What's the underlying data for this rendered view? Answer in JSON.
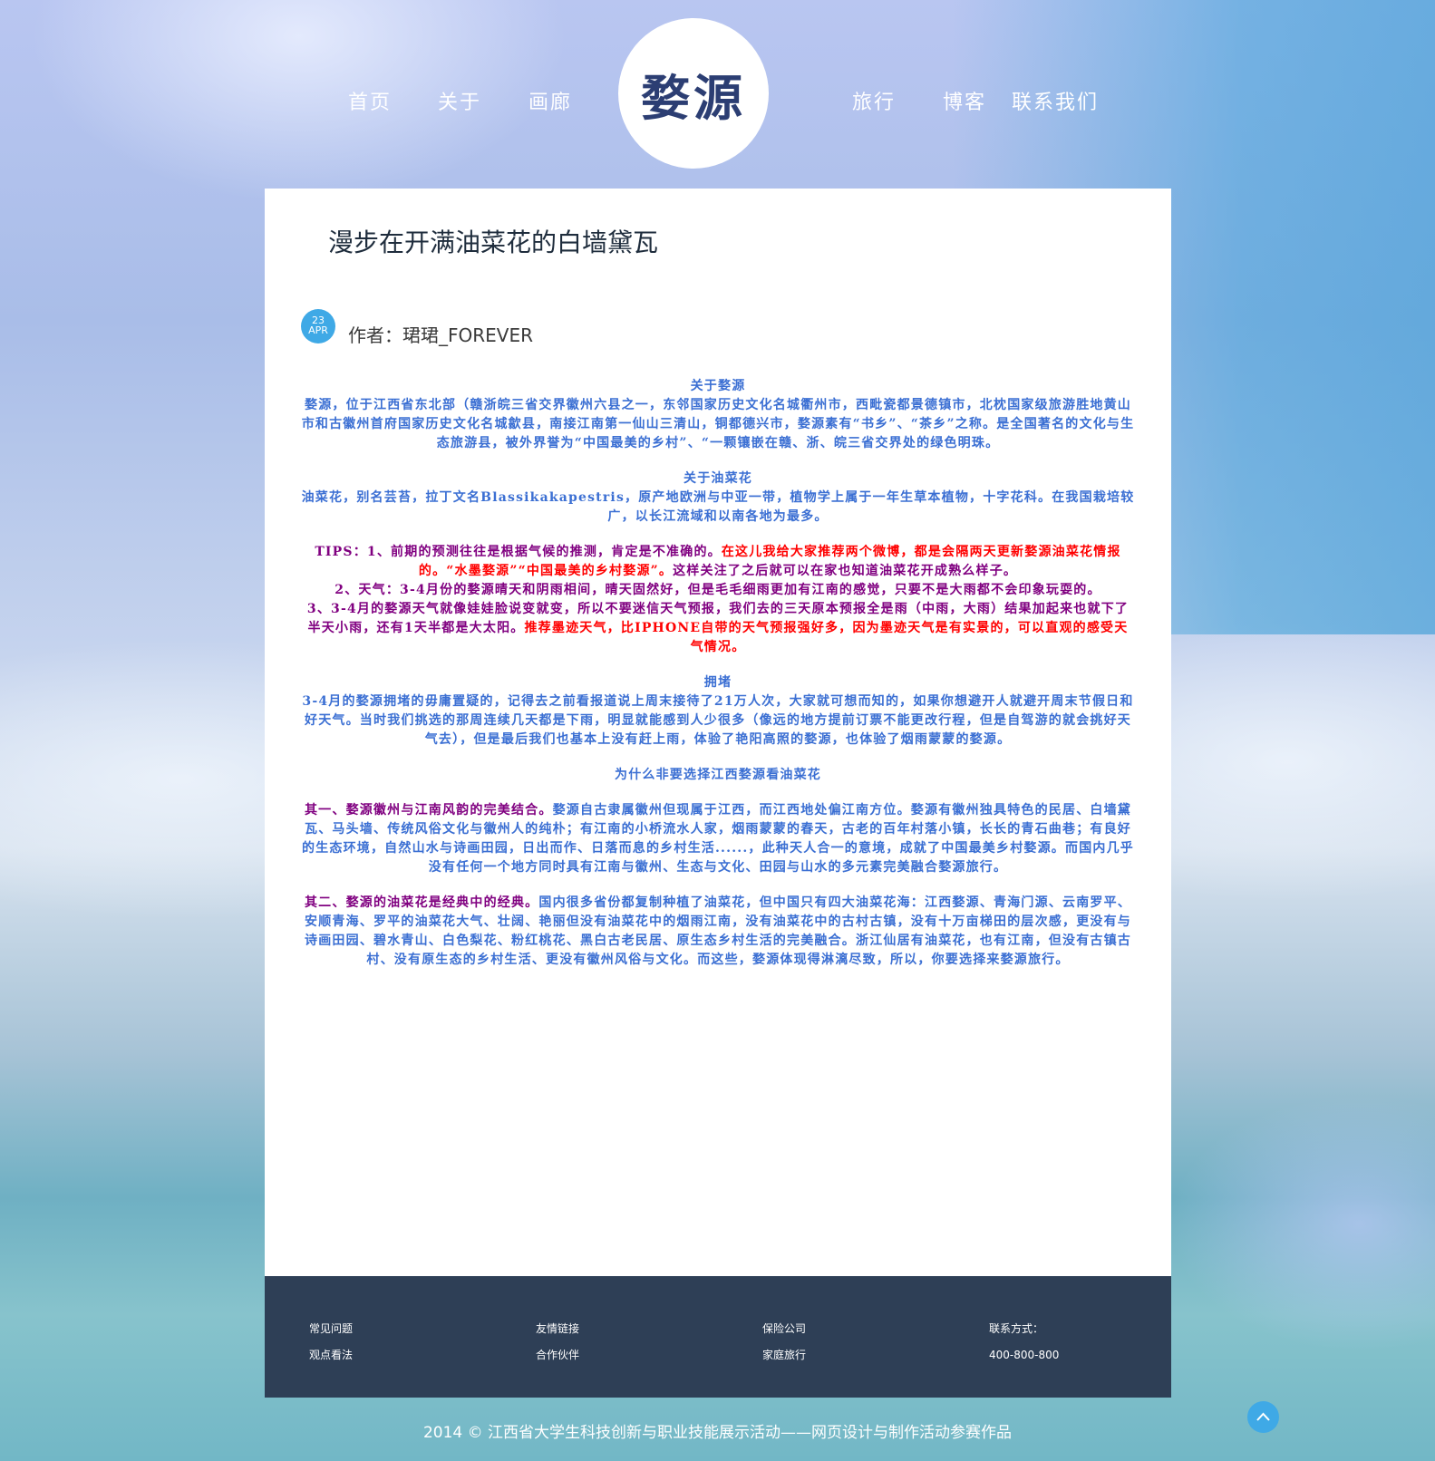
{
  "nav": {
    "items": [
      "首页",
      "关于",
      "画廊",
      "旅行",
      "博客",
      "联系我们"
    ],
    "logo_text": "婺源"
  },
  "post": {
    "title": "漫步在开满油菜花的白墙黛瓦",
    "date_day": "23",
    "date_month": "APR",
    "author": "作者：珺珺_FOREVER"
  },
  "article": {
    "s1_heading": "关于婺源",
    "s1_body": "婺源，位于江西省东北部（赣浙皖三省交界徽州六县之一，东邻国家历史文化名城衢州市，西毗瓷都景德镇市，北枕国家级旅游胜地黄山市和古徽州首府国家历史文化名城歙县，南接江南第一仙山三清山，铜都德兴市，婺源素有“书乡”、“茶乡”之称。是全国著名的文化与生态旅游县，被外界誉为“中国最美的乡村”、“一颗镶嵌在赣、浙、皖三省交界处的绿色明珠。",
    "s2_heading": "关于油菜花",
    "s2_body": "油菜花，别名芸苔，拉丁文名Blassikakapestris，原产地欧洲与中亚一带，植物学上属于一年生草本植物，十字花科。在我国栽培较广，以长江流域和以南各地为最多。",
    "tips_a": "TIPS：1、前期的预测往往是根据气候的推测，肯定是不准确的。",
    "tips_b": "在这儿我给大家推荐两个微博，都是会隔两天更新婺源油菜花情报的。“水墨婺源”“中国最美的乡村婺源”。",
    "tips_c": "这样关注了之后就可以在家也知道油菜花开成熟么样子。",
    "tips_2": "2、天气：3-4月份的婺源晴天和阴雨相间，晴天固然好，但是毛毛细雨更加有江南的感觉，只要不是大雨都不会印象玩耍的。",
    "tips_3a": "3、3-4月的婺源天气就像娃娃脸说变就变，所以不要迷信天气预报，我们去的三天原本预报全是雨（中雨，大雨）结果加起来也就下了半天小雨，还有1天半都是大太阳。",
    "tips_3b": "推荐墨迹天气，比IPHONE自带的天气预报强好多，因为墨迹天气是有实景的，可以直观的感受天气情况。",
    "s3_heading": "拥堵",
    "s3_body": "3-4月的婺源拥堵的毋庸置疑的，记得去之前看报道说上周末接待了21万人次，大家就可想而知的，如果你想避开人就避开周末节假日和好天气。当时我们挑选的那周连续几天都是下雨，明显就能感到人少很多（像远的地方提前订票不能更改行程，但是自驾游的就会挑好天气去），但是最后我们也基本上没有赶上雨，体验了艳阳高照的婺源，也体验了烟雨蒙蒙的婺源。",
    "s4_heading": "为什么非要选择江西婺源看油菜花",
    "r1_lead": "其一、婺源徽州与江南风韵的完美结合。",
    "r1_body": "婺源自古隶属徽州但现属于江西，而江西地处偏江南方位。婺源有徽州独具特色的民居、白墙黛瓦、马头墙、传统风俗文化与徽州人的纯朴；有江南的小桥流水人家，烟雨蒙蒙的春天，古老的百年村落小镇，长长的青石曲巷；有良好的生态环境，自然山水与诗画田园，日出而作、日落而息的乡村生活......，此种天人合一的意境，成就了中国最美乡村婺源。而国内几乎没有任何一个地方同时具有江南与徽州、生态与文化、田园与山水的多元素完美融合婺源旅行。",
    "r2_lead": "其二、婺源的油菜花是经典中的经典。",
    "r2_body": "国内很多省份都复制种植了油菜花，但中国只有四大油菜花海：江西婺源、青海门源、云南罗平、安顺青海、罗平的油菜花大气、壮阔、艳丽但没有油菜花中的烟雨江南，没有油菜花中的古村古镇，没有十万亩梯田的层次感，更没有与诗画田园、碧水青山、白色梨花、粉红桃花、黑白古老民居、原生态乡村生活的完美融合。浙江仙居有油菜花，也有江南，但没有古镇古村、没有原生态的乡村生活、更没有徽州风俗与文化。而这些，婺源体现得淋漓尽致，所以，你要选择来婺源旅行。"
  },
  "footer": {
    "col1": [
      "常见问题",
      "观点看法"
    ],
    "col2": [
      "友情链接",
      "合作伙伴"
    ],
    "col3": [
      "保险公司",
      "家庭旅行"
    ],
    "col4": [
      "联系方式：",
      "400-800-800"
    ],
    "copyright": "2014 © 江西省大学生科技创新与职业技能展示活动——网页设计与制作活动参赛作品"
  },
  "colors": {
    "accent": "#3fa9e6",
    "footer_bg": "#2e3f56",
    "article_blue": "#3b6fd3",
    "article_purple": "#800080",
    "article_red": "#ff0000"
  },
  "icons": [
    "back-to-top-icon"
  ]
}
